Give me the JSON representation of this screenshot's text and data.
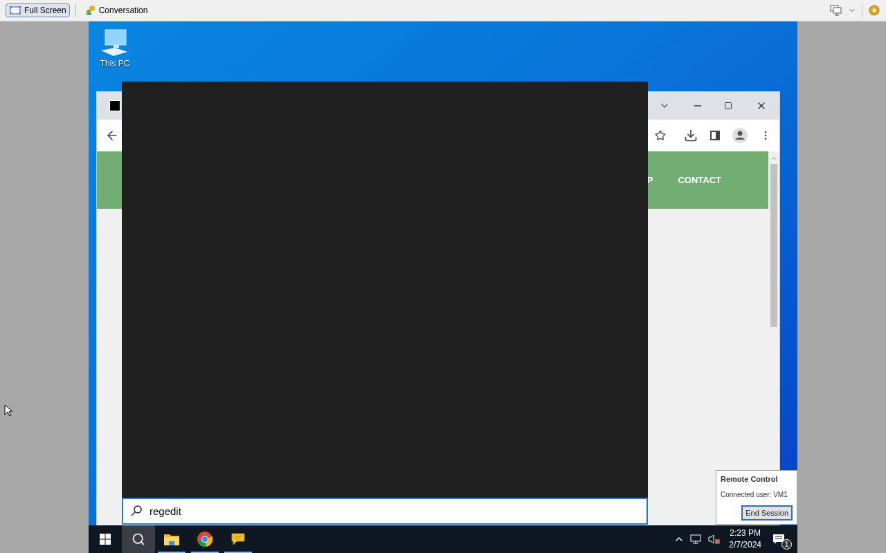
{
  "viewer_toolbar": {
    "buttons": [
      {
        "label": "Full Screen",
        "selected": true
      },
      {
        "label": "Conversation",
        "selected": false
      }
    ]
  },
  "desktop": {
    "icons": [
      {
        "label": "This PC"
      }
    ]
  },
  "browser": {
    "nav_links": [
      "P",
      "CONTACT"
    ]
  },
  "search": {
    "value": "regedit"
  },
  "taskbar": {
    "apps": [
      {
        "kind": "search",
        "selected": true,
        "running": false
      },
      {
        "kind": "explorer",
        "selected": false,
        "running": true
      },
      {
        "kind": "chrome",
        "selected": false,
        "running": true
      },
      {
        "kind": "chat",
        "selected": false,
        "running": true
      }
    ],
    "time": "2:23 PM",
    "date": "2/7/2024",
    "notification_count": "1"
  },
  "remote_popup": {
    "title": "Remote Control",
    "text": "Connected user: VM1",
    "button": "End Session"
  }
}
